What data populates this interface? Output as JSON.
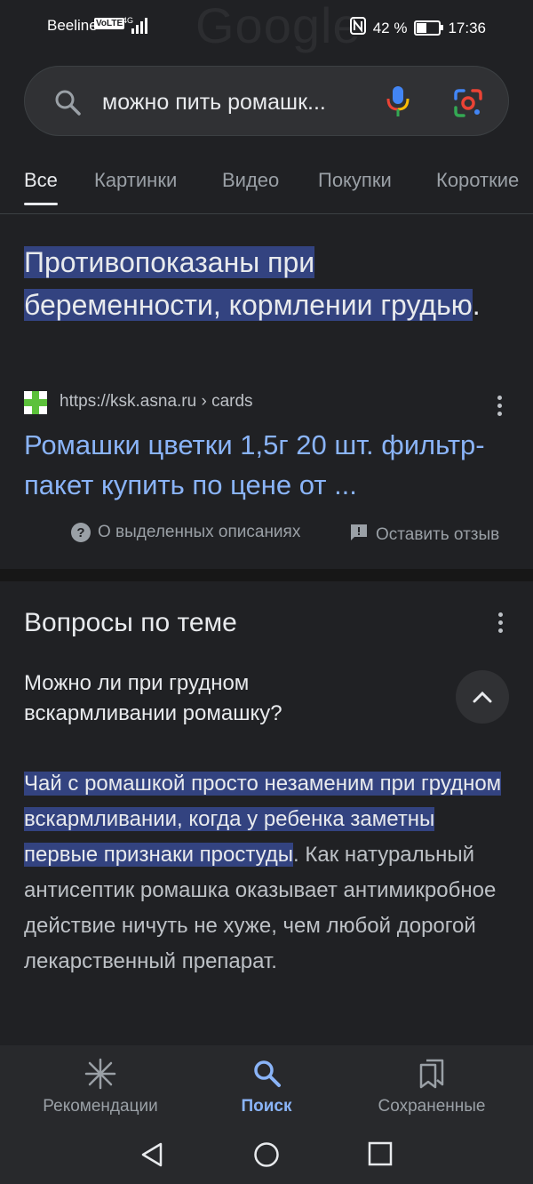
{
  "status_bar": {
    "carrier": "Beeline",
    "volte": "VoLTE",
    "network": "4G",
    "battery_percent": "42 %",
    "battery_level": 0.42,
    "time": "17:36"
  },
  "watermark": "Google",
  "search": {
    "query": "можно пить ромашк..."
  },
  "tabs": [
    "Все",
    "Картинки",
    "Видео",
    "Покупки",
    "Короткие"
  ],
  "featured_snippet": {
    "highlight": "Противопоказаны при беременности, кормлении грудью",
    "suffix": ".",
    "source_url": "https://ksk.asna.ru",
    "source_path": "› cards",
    "title": "Ромашки цветки 1,5г 20 шт. фильтр-пакет купить по цене от ...",
    "about_label": "О выделенных описаниях",
    "feedback_label": "Оставить отзыв"
  },
  "related_questions": {
    "title": "Вопросы по теме",
    "question": "Можно ли при грудном вскармливании ромашку?",
    "answer_highlight": "Чай с ромашкой просто незаменим при грудном вскармливании, когда у ребенка заметны первые признаки простуды",
    "answer_rest": ". Как натуральный антисептик ромашка оказывает антимикробное действие ничуть не хуже, чем любой дорогой лекарственный препарат."
  },
  "bottom_nav": {
    "items": [
      {
        "label": "Рекомендации",
        "icon": "asterisk-icon"
      },
      {
        "label": "Поиск",
        "icon": "search-icon"
      },
      {
        "label": "Сохраненные",
        "icon": "bookmarks-icon"
      }
    ],
    "active": "Поиск"
  },
  "colors": {
    "background": "#202124",
    "link": "#8ab4f8",
    "highlight": "#334380"
  }
}
